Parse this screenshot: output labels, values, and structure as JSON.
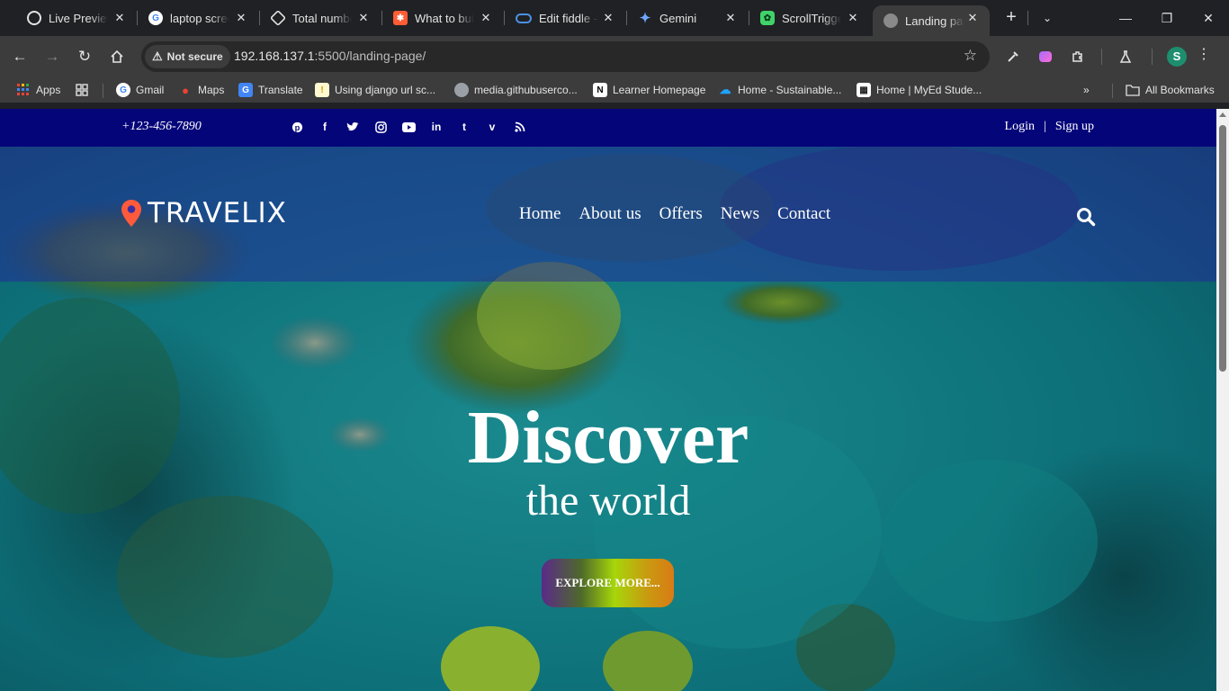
{
  "browser": {
    "tabs": [
      {
        "title": "Live Preview",
        "icon": "live-preview-icon"
      },
      {
        "title": "laptop screen",
        "icon": "google-icon"
      },
      {
        "title": "Total number",
        "icon": "codepen-icon"
      },
      {
        "title": "What to build",
        "icon": "hubspot-icon"
      },
      {
        "title": "Edit fiddle -",
        "icon": "jsfiddle-icon"
      },
      {
        "title": "Gemini",
        "icon": "gemini-icon"
      },
      {
        "title": "ScrollTrigger",
        "icon": "gsap-icon"
      },
      {
        "title": "Landing page",
        "icon": "globe-icon",
        "active": true
      }
    ],
    "security_label": "Not secure",
    "url_host": "192.168.137.1",
    "url_path": ":5500/landing-page/",
    "profile_initial": "S",
    "bookmarks": [
      {
        "label": "Apps",
        "icon": "apps-grid-icon"
      },
      {
        "label": "",
        "icon": "tab-groups-icon"
      },
      {
        "label": "Gmail",
        "icon": "google-icon"
      },
      {
        "label": "Maps",
        "icon": "maps-icon"
      },
      {
        "label": "Translate",
        "icon": "translate-icon"
      },
      {
        "label": "Using django url sc...",
        "icon": "lightbulb-icon"
      },
      {
        "label": "media.githubuserco...",
        "icon": "globe-icon"
      },
      {
        "label": "Learner Homepage",
        "icon": "notion-icon"
      },
      {
        "label": "Home - Sustainable...",
        "icon": "onedrive-icon"
      },
      {
        "label": "Home | MyEd Stude...",
        "icon": "myed-icon"
      }
    ],
    "all_bookmarks_label": "All Bookmarks"
  },
  "page": {
    "topbar": {
      "phone": "+123-456-7890",
      "socials": [
        "pinterest",
        "facebook",
        "twitter",
        "instagram",
        "youtube",
        "linkedin",
        "tumblr",
        "vimeo",
        "rss"
      ],
      "login": "Login",
      "divider": "|",
      "signup": "Sign up"
    },
    "brand": "TRAVELIX",
    "nav": [
      "Home",
      "About us",
      "Offers",
      "News",
      "Contact"
    ],
    "hero": {
      "title": "Discover",
      "subtitle": "the world",
      "cta": "EXPLORE MORE..."
    }
  },
  "colors": {
    "topbar": "#05057a",
    "logo_pin": "#ff5a3c",
    "water": "#0b6b72"
  }
}
